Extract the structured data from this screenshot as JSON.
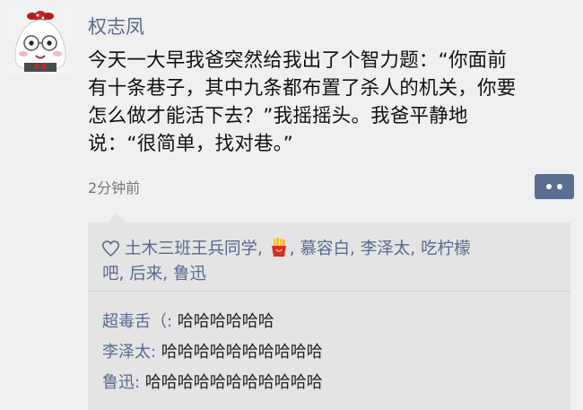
{
  "post": {
    "author": "权志凤",
    "content_lines": [
      "今天一大早我爸突然给我出了个智力题：“你面前",
      "有十条巷子，其中九条都布置了杀人的机关，你要",
      "怎么做才能活下去？”我摇摇头。我爸平静地",
      "说：“很简单，找对巷。”"
    ],
    "time": "2分钟前"
  },
  "likes": {
    "line1_a": "土木三班王兵同学,",
    "line1_b": ", 慕容白, 李泽太, 吃柠檬",
    "line2": "吧, 后来, 鲁迅"
  },
  "comments": [
    {
      "name": "超毒舌（:",
      "text": " 哈哈哈哈哈哈"
    },
    {
      "name": "李泽太:",
      "text": " 哈哈哈哈哈哈哈哈哈哈"
    },
    {
      "name": "鲁迅:",
      "text": " 哈哈哈哈哈哈哈哈哈哈哈"
    }
  ],
  "colors": {
    "name_blue": "#57698f",
    "background": "#f0f0f0",
    "comment_bg": "#e4e4e4"
  },
  "icons": [
    "avatar-rice-ball",
    "heart-icon",
    "fries-emoji",
    "more-dots-icon"
  ]
}
